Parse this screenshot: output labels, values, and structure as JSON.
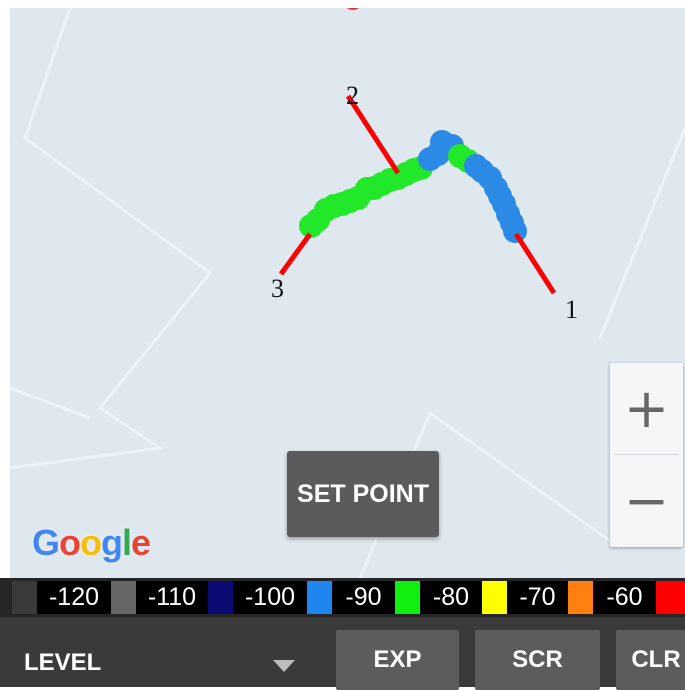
{
  "map": {
    "route_labels": [
      "1",
      "2",
      "3"
    ],
    "zoom_in_label": "+",
    "zoom_out_label": "−",
    "set_point_label": "SET POINT",
    "google_logo": [
      "G",
      "o",
      "o",
      "g",
      "l",
      "e"
    ],
    "google_colors": [
      "#4285F4",
      "#EA4335",
      "#FBBC05",
      "#4285F4",
      "#34A853",
      "#EA4335"
    ]
  },
  "legend": {
    "items": [
      {
        "color": "#3a3a3a",
        "label": "-120"
      },
      {
        "color": "#666666",
        "label": "-110"
      },
      {
        "color": "#0b0b73",
        "label": "-100"
      },
      {
        "color": "#1f86f0",
        "label": "-90"
      },
      {
        "color": "#0ff00f",
        "label": "-80"
      },
      {
        "color": "#ffff00",
        "label": "-70"
      },
      {
        "color": "#ff7f10",
        "label": "-60"
      },
      {
        "color": "#ff0000",
        "label": ""
      }
    ]
  },
  "bottombar": {
    "level_label": "LEVEL",
    "exp_label": "EXP",
    "scr_label": "SCR",
    "clr_label": "CLR"
  },
  "signal_colors": {
    "green": "#22e82a",
    "blue": "#2b8ae6",
    "marker": "#ff0000"
  }
}
